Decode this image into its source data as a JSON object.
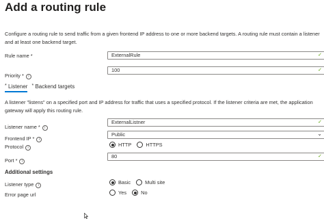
{
  "title": "Add a routing rule",
  "description": "Configure a routing rule to send traffic from a given frontend IP address to one or more backend targets. A routing rule must contain a listener and at least one backend target.",
  "rule_name": {
    "label": "Rule name *",
    "value": "ExternalRule"
  },
  "priority": {
    "label": "Priority *",
    "value": "100"
  },
  "tabs": [
    {
      "label": "Listener",
      "required_mark": "*"
    },
    {
      "label": "Backend targets",
      "required_mark": "*"
    }
  ],
  "listener": {
    "description": "A listener \"listens\" on a specified port and IP address for traffic that uses a specified protocol. If the listener criteria are met, the application gateway will apply this routing rule.",
    "listener_name": {
      "label": "Listener name *",
      "value": "ExternalListner"
    },
    "frontend_ip": {
      "label": "Frontend IP *",
      "value": "Public"
    },
    "protocol": {
      "label": "Protocol",
      "options": [
        "HTTP",
        "HTTPS"
      ],
      "selected": "HTTP"
    },
    "port": {
      "label": "Port *",
      "value": "80"
    }
  },
  "additional_settings": {
    "heading": "Additional settings",
    "listener_type": {
      "label": "Listener type",
      "options": [
        "Basic",
        "Multi site"
      ],
      "selected": "Basic"
    },
    "error_page_url": {
      "label": "Error page url",
      "options": [
        "Yes",
        "No"
      ],
      "selected": "No"
    }
  },
  "icons": {
    "info": "info-icon",
    "check": "check-icon",
    "dropdown": "chevron-down-icon",
    "cursor": "mouse-cursor-icon"
  },
  "colors": {
    "tab_underline": "#0078d4",
    "valid_check": "#57a300",
    "border": "#8a8886"
  }
}
